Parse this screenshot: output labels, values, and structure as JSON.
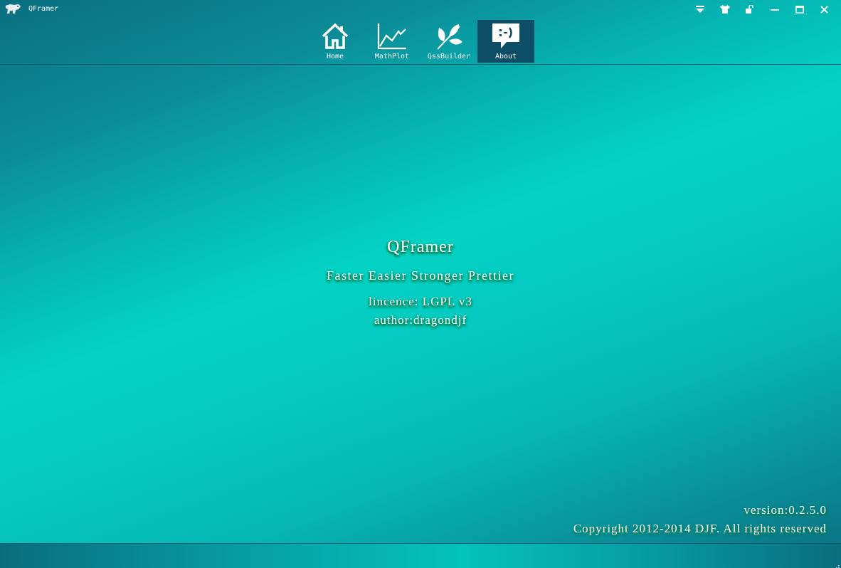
{
  "window": {
    "title": "QFramer",
    "controls": [
      {
        "name": "menu-dropdown-icon"
      },
      {
        "name": "skin-shirt-icon"
      },
      {
        "name": "unlock-icon"
      },
      {
        "name": "minimize-icon"
      },
      {
        "name": "maximize-icon"
      },
      {
        "name": "close-icon"
      }
    ]
  },
  "nav": {
    "items": [
      {
        "label": "Home",
        "icon": "home-icon",
        "active": false
      },
      {
        "label": "MathPlot",
        "icon": "line-chart-icon",
        "active": false
      },
      {
        "label": "QssBuilder",
        "icon": "leaf-icon",
        "active": false
      },
      {
        "label": "About",
        "icon": "smiley-speech-bubble-icon",
        "active": true
      }
    ]
  },
  "about": {
    "title": "QFramer",
    "slogan": "Faster Easier Stronger Prettier",
    "licence": "lincence: LGPL v3",
    "author": "author:dragondjf",
    "version": "version:0.2.5.0",
    "copyright": "Copyright 2012-2014 DJF. All rights reserved"
  },
  "colors": {
    "active_tab": "#0d4e66",
    "text_glow": "#0b7d45",
    "accent": "#03d3c5"
  }
}
